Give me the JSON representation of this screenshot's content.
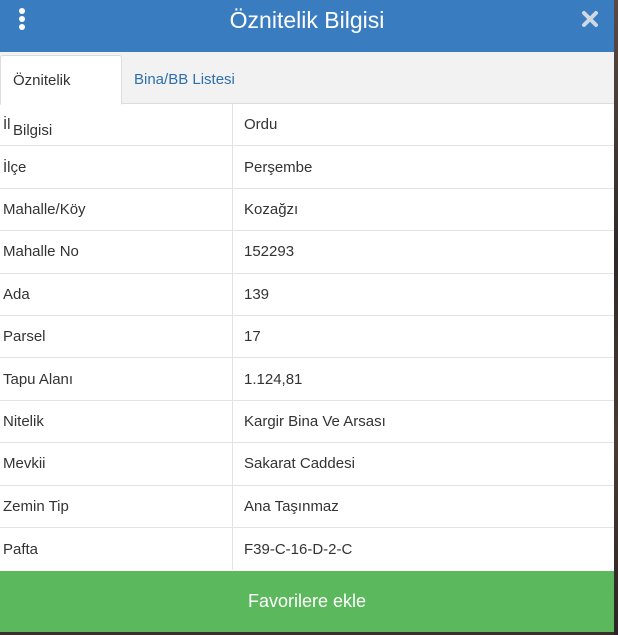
{
  "header": {
    "title": "Öznitelik Bilgisi",
    "menu_icon": "kebab-menu-icon",
    "close_icon": "close-icon",
    "background": "#3a7cc0"
  },
  "tabs": [
    {
      "label": "Öznitelik Bilgisi",
      "active": true
    },
    {
      "label": "Bina/BB Listesi",
      "active": false
    }
  ],
  "attributes": [
    {
      "key": "İl",
      "value": "Ordu"
    },
    {
      "key": "İlçe",
      "value": "Perşembe"
    },
    {
      "key": "Mahalle/Köy",
      "value": "Kozağzı"
    },
    {
      "key": "Mahalle No",
      "value": "152293"
    },
    {
      "key": "Ada",
      "value": "139"
    },
    {
      "key": "Parsel",
      "value": "17"
    },
    {
      "key": "Tapu Alanı",
      "value": "1.124,81"
    },
    {
      "key": "Nitelik",
      "value": "Kargir Bina Ve Arsası"
    },
    {
      "key": "Mevkii",
      "value": "Sakarat Caddesi"
    },
    {
      "key": "Zemin Tip",
      "value": "Ana Taşınmaz"
    },
    {
      "key": "Pafta",
      "value": "F39-C-16-D-2-C"
    }
  ],
  "footer": {
    "button_label": "Favorilere ekle",
    "button_color": "#5cb85c"
  }
}
